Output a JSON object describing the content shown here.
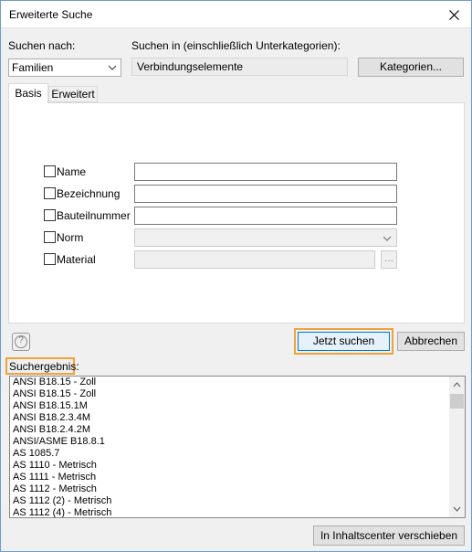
{
  "window": {
    "title": "Erweiterte Suche"
  },
  "search_by": {
    "label": "Suchen nach:",
    "selected": "Familien"
  },
  "search_in": {
    "label": "Suchen in (einschließlich Unterkategorien):",
    "value": "Verbindungselemente"
  },
  "categories_button": "Kategorien...",
  "tabs": [
    {
      "label": "Basis",
      "active": true
    },
    {
      "label": "Erweitert",
      "active": false
    }
  ],
  "fields": {
    "name": "Name",
    "designation": "Bezeichnung",
    "part_number": "Bauteilnummer",
    "norm": "Norm",
    "material": "Material",
    "material_browse": "..."
  },
  "buttons": {
    "search_now": "Jetzt suchen",
    "cancel": "Abbrechen",
    "move_to_content_center": "In Inhaltscenter verschieben",
    "help": "?"
  },
  "results": {
    "label": "Suchergebnis:",
    "items": [
      "ANSI B18.15 - Zoll",
      "ANSI B18.15 - Zoll",
      "ANSI B18.15.1M",
      "ANSI B18.2.3.4M",
      "ANSI B18.2.4.2M",
      "ANSI/ASME B18.8.1",
      "AS 1085.7",
      "AS 1110 - Metrisch",
      "AS 1111 - Metrisch",
      "AS 1112 - Metrisch",
      "AS 1112 (2) - Metrisch",
      "AS 1112 (4) - Metrisch"
    ]
  },
  "colors": {
    "highlight": "#f0a33a",
    "focus_border": "#0078d7"
  }
}
